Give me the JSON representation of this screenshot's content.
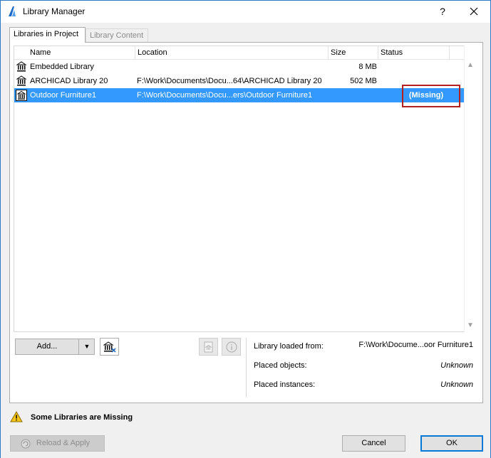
{
  "window": {
    "title": "Library Manager",
    "help": "?"
  },
  "tabs": [
    {
      "label": "Libraries in Project",
      "active": true
    },
    {
      "label": "Library Content",
      "active": false
    }
  ],
  "table": {
    "columns": [
      "Name",
      "Location",
      "Size",
      "Status"
    ],
    "rows": [
      {
        "name": "Embedded Library",
        "location": "",
        "size": "8 MB",
        "status": ""
      },
      {
        "name": "ARCHICAD Library 20",
        "location": "F:\\Work\\Documents\\Docu...64\\ARCHICAD Library 20",
        "size": "502 MB",
        "status": ""
      },
      {
        "name": "Outdoor Furniture1",
        "location": "F:\\Work\\Documents\\Docu...ers\\Outdoor Furniture1",
        "size": "",
        "status": "(Missing)",
        "selected": true
      }
    ]
  },
  "toolbar": {
    "add_label": "Add..."
  },
  "info": {
    "loaded_from_label": "Library loaded from:",
    "loaded_from_value": "F:\\Work\\Docume...oor Furniture1",
    "placed_objects_label": "Placed objects:",
    "placed_objects_value": "Unknown",
    "placed_instances_label": "Placed instances:",
    "placed_instances_value": "Unknown"
  },
  "warning": {
    "text": "Some Libraries are Missing"
  },
  "footer": {
    "reload_apply_label": "Reload & Apply",
    "cancel_label": "Cancel",
    "ok_label": "OK"
  },
  "colors": {
    "selection": "#3399ff",
    "highlight_box": "#b41f22",
    "default_button_border": "#0078d7"
  }
}
